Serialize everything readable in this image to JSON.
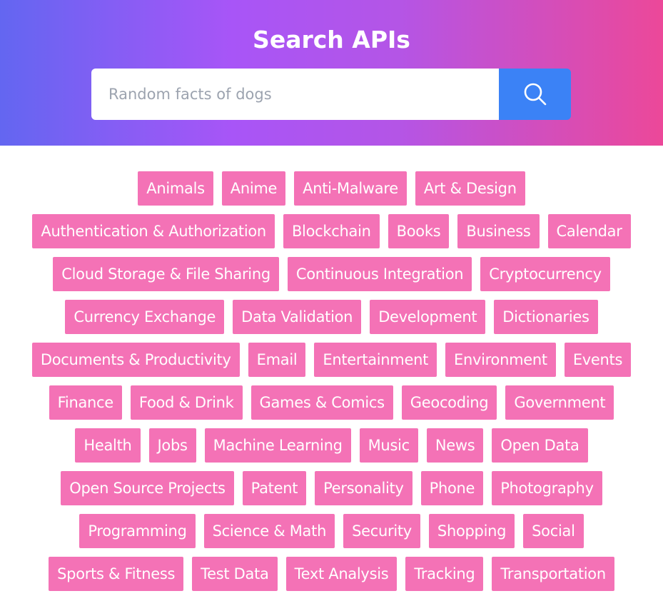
{
  "header": {
    "title": "Search APIs"
  },
  "search": {
    "placeholder": "Random facts of dogs",
    "value": "",
    "button_icon": "search-icon"
  },
  "categories": [
    "Animals",
    "Anime",
    "Anti-Malware",
    "Art & Design",
    "Authentication & Authorization",
    "Blockchain",
    "Books",
    "Business",
    "Calendar",
    "Cloud Storage & File Sharing",
    "Continuous Integration",
    "Cryptocurrency",
    "Currency Exchange",
    "Data Validation",
    "Development",
    "Dictionaries",
    "Documents & Productivity",
    "Email",
    "Entertainment",
    "Environment",
    "Events",
    "Finance",
    "Food & Drink",
    "Games & Comics",
    "Geocoding",
    "Government",
    "Health",
    "Jobs",
    "Machine Learning",
    "Music",
    "News",
    "Open Data",
    "Open Source Projects",
    "Patent",
    "Personality",
    "Phone",
    "Photography",
    "Programming",
    "Science & Math",
    "Security",
    "Shopping",
    "Social",
    "Sports & Fitness",
    "Test Data",
    "Text Analysis",
    "Tracking",
    "Transportation"
  ],
  "colors": {
    "gradient_start": "#6366f1",
    "gradient_end": "#ec4899",
    "search_button": "#3b82f6",
    "tag_background": "#f472b6",
    "tag_text": "#ffffff"
  }
}
